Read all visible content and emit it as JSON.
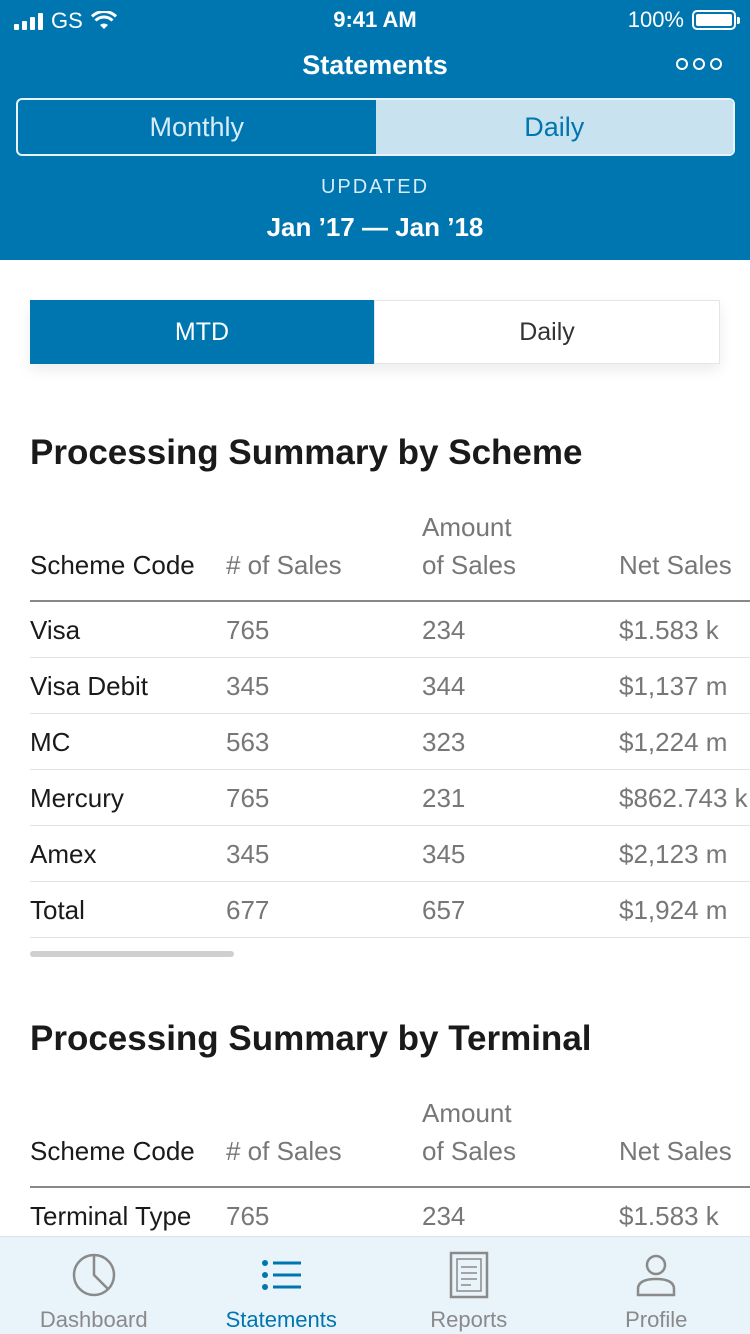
{
  "status_bar": {
    "carrier": "GS",
    "time": "9:41 AM",
    "battery": "100%"
  },
  "header": {
    "title": "Statements",
    "segments": [
      "Monthly",
      "Daily"
    ],
    "active_segment": "Daily",
    "updated_label": "UPDATED",
    "date_range": "Jan ’17 — Jan ’18"
  },
  "toggle": {
    "options": [
      "MTD",
      "Daily"
    ],
    "active": "MTD"
  },
  "scheme_table": {
    "title": "Processing Summary by Scheme",
    "headers": [
      "Scheme Code",
      "# of Sales",
      "Amount of Sales",
      "Net Sales"
    ],
    "header_lines": {
      "amount_top": "Amount",
      "amount_bottom": "of Sales"
    },
    "rows": [
      [
        "Visa",
        "765",
        "234",
        "$1.583 k"
      ],
      [
        "Visa Debit",
        "345",
        "344",
        "$1,137 m"
      ],
      [
        "MC",
        "563",
        "323",
        "$1,224 m"
      ],
      [
        "Mercury",
        "765",
        "231",
        "$862.743 k"
      ],
      [
        "Amex",
        "345",
        "345",
        "$2,123 m"
      ],
      [
        "Total",
        "677",
        "657",
        "$1,924 m"
      ]
    ]
  },
  "terminal_table": {
    "title": "Processing Summary by Terminal",
    "headers": [
      "Scheme Code",
      "# of Sales",
      "Amount of Sales",
      "Net Sales"
    ],
    "header_lines": {
      "amount_top": "Amount",
      "amount_bottom": "of Sales"
    },
    "rows": [
      [
        "Terminal Type",
        "765",
        "234",
        "$1.583 k"
      ]
    ]
  },
  "tabbar": {
    "items": [
      {
        "label": "Dashboard",
        "icon": "pie-chart-icon"
      },
      {
        "label": "Statements",
        "icon": "list-icon"
      },
      {
        "label": "Reports",
        "icon": "document-icon"
      },
      {
        "label": "Profile",
        "icon": "person-icon"
      }
    ],
    "active": "Statements"
  },
  "colors": {
    "brand": "#0076b0",
    "tab_bg": "#e9f3fa",
    "muted": "#777777"
  }
}
